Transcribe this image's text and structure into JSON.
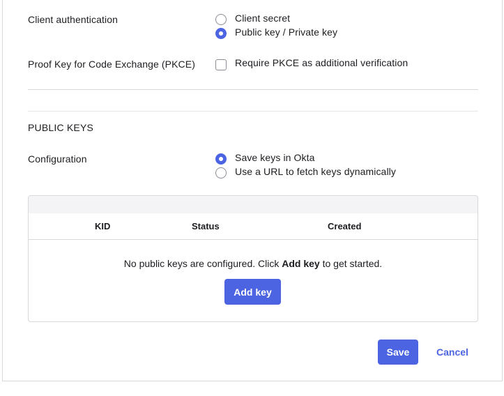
{
  "client_auth": {
    "label": "Client authentication",
    "options": [
      {
        "label": "Client secret",
        "checked": false
      },
      {
        "label": "Public key / Private key",
        "checked": true
      }
    ]
  },
  "pkce": {
    "label": "Proof Key for Code Exchange (PKCE)",
    "checkbox_label": "Require PKCE as additional verification",
    "checked": false
  },
  "public_keys": {
    "title": "PUBLIC KEYS",
    "config_label": "Configuration",
    "options": [
      {
        "label": "Save keys in Okta",
        "checked": true
      },
      {
        "label": "Use a URL to fetch keys dynamically",
        "checked": false
      }
    ],
    "table": {
      "columns": [
        "KID",
        "Status",
        "Created"
      ],
      "empty_prefix": "No public keys are configured. Click ",
      "empty_bold": "Add key",
      "empty_suffix": " to get started.",
      "add_key_label": "Add key"
    }
  },
  "footer": {
    "save_label": "Save",
    "cancel_label": "Cancel"
  },
  "colors": {
    "accent": "#4c64e1",
    "border": "#d7d7dc"
  }
}
